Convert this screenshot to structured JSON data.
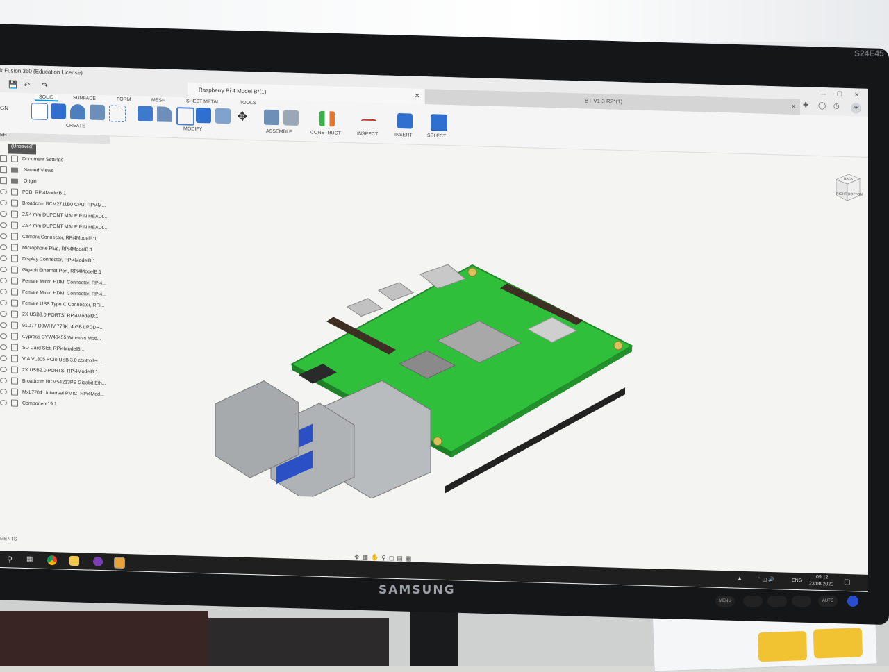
{
  "app": {
    "title": "k Fusion 360 (Education License)",
    "workspace": "GN",
    "quick_actions": [
      "save",
      "undo",
      "redo"
    ]
  },
  "tabs": [
    {
      "label": "Raspberry Pi 4 Model B*(1)",
      "active": true
    },
    {
      "label": "BT V1.3 R2*(1)",
      "active": false
    }
  ],
  "user_initials": "AP",
  "toolbar": {
    "workspace_tabs": [
      "SOLID",
      "SURFACE",
      "FORM",
      "MESH",
      "SHEET METAL",
      "TOOLS"
    ],
    "active_workspace_tab": "SOLID",
    "groups": [
      "CREATE",
      "MODIFY",
      "ASSEMBLE",
      "CONSTRUCT",
      "INSPECT",
      "INSERT",
      "SELECT"
    ]
  },
  "browser": {
    "header": "ER",
    "root": "(Unsaved)",
    "items": [
      {
        "label": "Document Settings",
        "type": "gear"
      },
      {
        "label": "Named Views",
        "type": "folder"
      },
      {
        "label": "Origin",
        "type": "folder"
      },
      {
        "label": "PCB, RPi4ModelB:1",
        "type": "component"
      },
      {
        "label": "Broadcom BCM2711B0 CPU, RPi4M...",
        "type": "component"
      },
      {
        "label": "2.54 mm DUPONT MALE PIN HEADI...",
        "type": "component"
      },
      {
        "label": "2.54 mm DUPONT MALE PIN HEADI...",
        "type": "component"
      },
      {
        "label": "Camera Connector, RPi4ModelB:1",
        "type": "component"
      },
      {
        "label": "Microphone Plug, RPi4ModelB:1",
        "type": "component"
      },
      {
        "label": "Display Connector, RPi4ModelB:1",
        "type": "component"
      },
      {
        "label": "Gigabit Ethernet Port, RPi4ModelB:1",
        "type": "component"
      },
      {
        "label": "Female Micro HDMI Connector, RPi4...",
        "type": "component"
      },
      {
        "label": "Female Micro HDMI Connector, RPi4...",
        "type": "component"
      },
      {
        "label": "Female USB Type C Connector, RPi...",
        "type": "component"
      },
      {
        "label": "2X USB3.0 PORTS, RPi4ModelB:1",
        "type": "component"
      },
      {
        "label": "91D77 D9WHV 778K, 4 GB LPDDR...",
        "type": "component"
      },
      {
        "label": "Cypress CYW43455 Wireless Mod...",
        "type": "component"
      },
      {
        "label": "SD Card Slot, RPi4ModelB:1",
        "type": "component"
      },
      {
        "label": "VIA VL805 PCIe USB 3.0 controller...",
        "type": "component"
      },
      {
        "label": "2X USB2.0 PORTS, RPi4ModelB:1",
        "type": "component"
      },
      {
        "label": "Broadcom BCM54213PE Gigabit Eth...",
        "type": "component"
      },
      {
        "label": "MxL7704 Universal PMIC, RPi4Mod...",
        "type": "component"
      },
      {
        "label": "Component19:1",
        "type": "component"
      }
    ]
  },
  "comments_label": "MENTS",
  "viewcube": {
    "labels": [
      "BACK",
      "RIGHT",
      "BOTTOM"
    ]
  },
  "taskbar": {
    "lang": "ENG",
    "time": "09:12",
    "date": "23/08/2020"
  },
  "monitor": {
    "brand": "SAMSUNG",
    "model": "S24E45",
    "buttons": [
      "MENU",
      "",
      "",
      "",
      "AUTO"
    ]
  }
}
